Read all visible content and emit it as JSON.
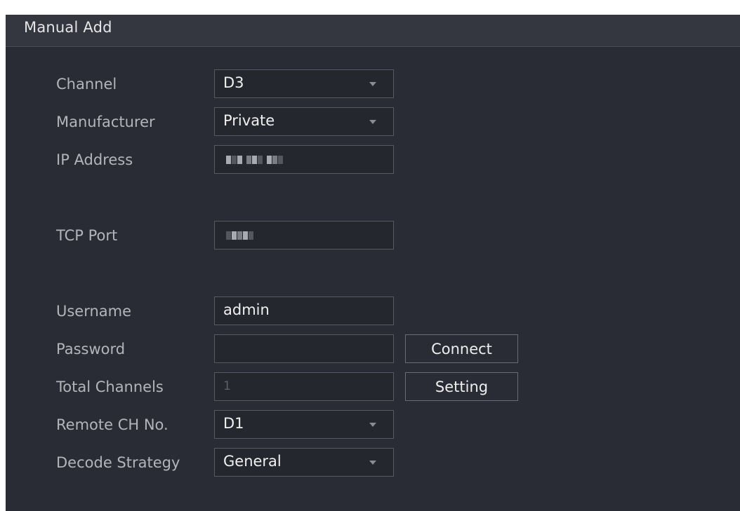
{
  "dialog": {
    "title": "Manual Add"
  },
  "form": {
    "channel": {
      "label": "Channel",
      "value": "D3"
    },
    "manufacturer": {
      "label": "Manufacturer",
      "value": "Private"
    },
    "ip_address": {
      "label": "IP Address"
    },
    "tcp_port": {
      "label": "TCP Port"
    },
    "username": {
      "label": "Username",
      "value": "admin"
    },
    "password": {
      "label": "Password",
      "value": ""
    },
    "total_channels": {
      "label": "Total Channels",
      "value": "1"
    },
    "remote_ch_no": {
      "label": "Remote CH No.",
      "value": "D1"
    },
    "decode_strategy": {
      "label": "Decode Strategy",
      "value": "General"
    }
  },
  "buttons": {
    "connect": "Connect",
    "setting": "Setting"
  },
  "icons": {
    "dropdown": "chevron-down-icon"
  },
  "colors": {
    "background": "#2a2c35",
    "titlebar": "#343640",
    "label": "#b3b5ba",
    "value": "#f0f0f0",
    "border": "#585a63"
  }
}
